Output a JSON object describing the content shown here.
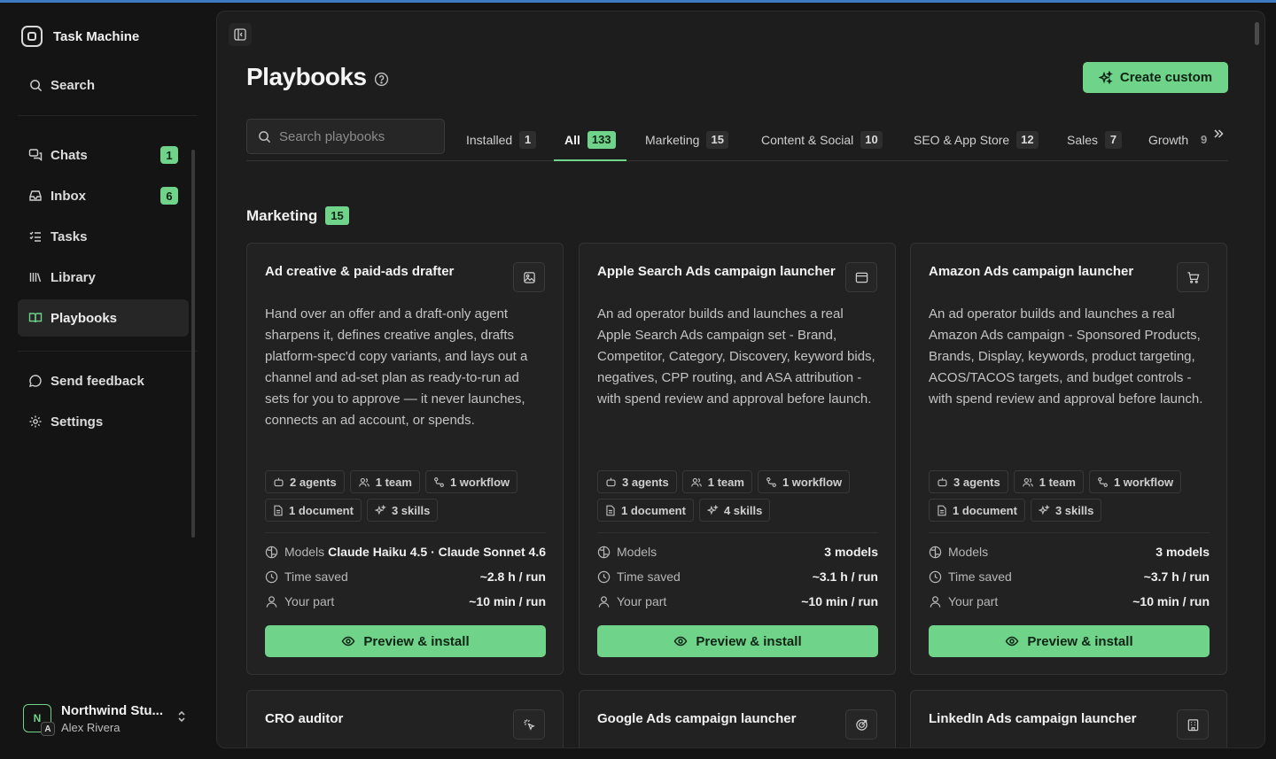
{
  "app": {
    "name": "Task Machine"
  },
  "sidebar": {
    "search_label": "Search",
    "items": [
      {
        "label": "Chats",
        "badge": "1",
        "icon": "chat-icon"
      },
      {
        "label": "Inbox",
        "badge": "6",
        "icon": "inbox-icon"
      },
      {
        "label": "Tasks",
        "badge": "",
        "icon": "tasks-icon"
      },
      {
        "label": "Library",
        "badge": "",
        "icon": "library-icon"
      },
      {
        "label": "Playbooks",
        "badge": "",
        "icon": "playbooks-icon",
        "active": true
      }
    ],
    "feedback_label": "Send feedback",
    "settings_label": "Settings",
    "workspace": {
      "name": "Northwind Stu...",
      "user": "Alex Rivera",
      "avatar_letter": "N",
      "avatar_sub": "A"
    }
  },
  "page": {
    "title": "Playbooks",
    "create_label": "Create custom",
    "search_placeholder": "Search playbooks",
    "tabs": [
      {
        "label": "Installed",
        "count": "1"
      },
      {
        "label": "All",
        "count": "133",
        "active": true
      },
      {
        "label": "Marketing",
        "count": "15"
      },
      {
        "label": "Content & Social",
        "count": "10"
      },
      {
        "label": "SEO & App Store",
        "count": "12"
      },
      {
        "label": "Sales",
        "count": "7"
      },
      {
        "label": "Growth",
        "count": "9"
      }
    ],
    "section": {
      "title": "Marketing",
      "count": "15"
    }
  },
  "labels": {
    "models": "Models",
    "time_saved": "Time saved",
    "your_part": "Your part",
    "preview": "Preview & install"
  },
  "cards": [
    {
      "title": "Ad creative & paid-ads drafter",
      "icon": "image-icon",
      "desc": "Hand over an offer and a draft-only agent sharpens it, defines creative angles, drafts platform-spec'd copy variants, and lays out a channel and ad-set plan as ready-to-run ad sets for you to approve — it never launches, connects an ad account, or spends.",
      "agents": "2 agents",
      "team": "1 team",
      "workflow": "1 workflow",
      "document": "1 document",
      "skills": "3 skills",
      "models": "Claude Haiku 4.5 · Claude Sonnet 4.6",
      "time_saved": "~2.8 h / run",
      "your_part": "~10 min / run"
    },
    {
      "title": "Apple Search Ads campaign launcher",
      "icon": "browser-icon",
      "desc": "An ad operator builds and launches a real Apple Search Ads campaign set - Brand, Competitor, Category, Discovery, keyword bids, negatives, CPP routing, and ASA attribution - with spend review and approval before launch.",
      "agents": "3 agents",
      "team": "1 team",
      "workflow": "1 workflow",
      "document": "1 document",
      "skills": "4 skills",
      "models": "3 models",
      "time_saved": "~3.1 h / run",
      "your_part": "~10 min / run"
    },
    {
      "title": "Amazon Ads campaign launcher",
      "icon": "cart-icon",
      "desc": "An ad operator builds and launches a real Amazon Ads campaign - Sponsored Products, Brands, Display, keywords, product targeting, ACOS/TACOS targets, and budget controls - with spend review and approval before launch.",
      "agents": "3 agents",
      "team": "1 team",
      "workflow": "1 workflow",
      "document": "1 document",
      "skills": "3 skills",
      "models": "3 models",
      "time_saved": "~3.7 h / run",
      "your_part": "~10 min / run"
    },
    {
      "title": "CRO auditor",
      "icon": "pointer-click-icon"
    },
    {
      "title": "Google Ads campaign launcher",
      "icon": "target-icon"
    },
    {
      "title": "LinkedIn Ads campaign launcher",
      "icon": "building-icon"
    }
  ],
  "colors": {
    "accent": "#6fd38a",
    "background": "#141414",
    "panel": "#1d1d1d",
    "card": "#222222"
  }
}
